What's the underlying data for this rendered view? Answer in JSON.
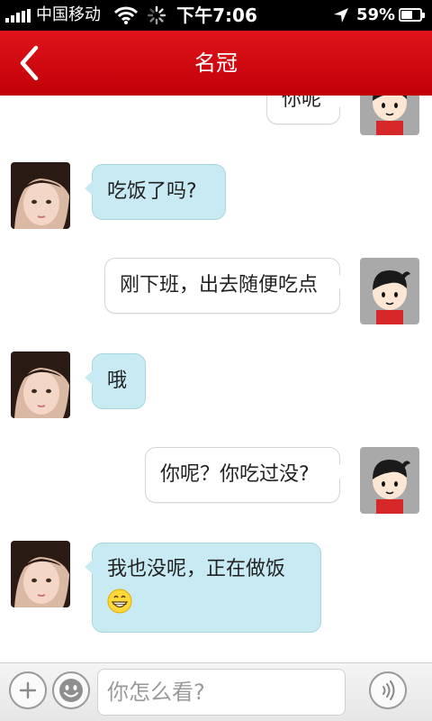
{
  "status_bar": {
    "carrier": "中国移动",
    "time": "下午7:06",
    "battery_percent": "59%",
    "battery_level": 0.59,
    "icons": [
      "signal-bars-icon",
      "wifi-icon",
      "activity-spinner-icon",
      "location-arrow-icon",
      "battery-icon"
    ]
  },
  "nav": {
    "title": "名冠",
    "back_icon": "chevron-left-icon"
  },
  "colors": {
    "nav_red": "#d40d14",
    "incoming_bubble": "#c8eaf2",
    "outgoing_bubble": "#ffffff"
  },
  "messages": [
    {
      "side": "out",
      "text": "你呢",
      "partial": true
    },
    {
      "side": "in",
      "text": "吃饭了吗?"
    },
    {
      "side": "out",
      "text": "刚下班，出去随便吃点"
    },
    {
      "side": "in",
      "text": "哦"
    },
    {
      "side": "out",
      "text": "你呢？你吃过没?"
    },
    {
      "side": "in",
      "text": "我也没呢，正在做饭",
      "emoji": "grinning-face-icon"
    }
  ],
  "input_bar": {
    "placeholder": "你怎么看?",
    "icons": [
      "plus-icon",
      "smiley-icon",
      "voice-icon"
    ]
  }
}
